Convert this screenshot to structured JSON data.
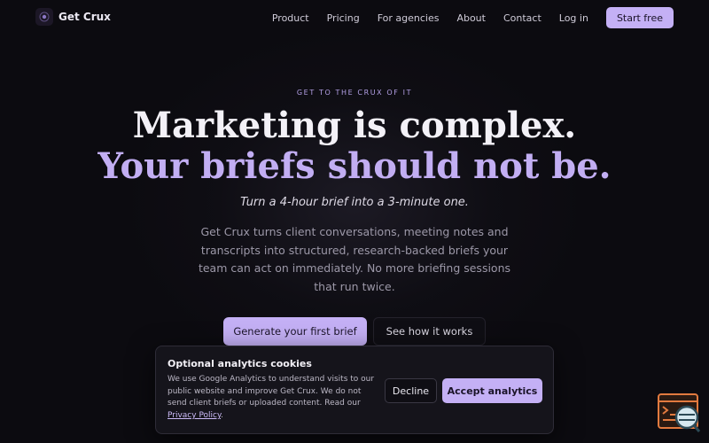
{
  "nav": {
    "brand": "Get Crux",
    "links": [
      "Product",
      "Pricing",
      "For agencies",
      "About",
      "Contact",
      "Log in"
    ],
    "cta": "Start free"
  },
  "hero": {
    "eyebrow": "GET TO THE CRUX OF IT",
    "headline_line1": "Marketing is complex.",
    "headline_line2": "Your briefs should not be.",
    "tagline": "Turn a 4-hour brief into a 3-minute one.",
    "description": "Get Crux turns client conversations, meeting notes and transcripts into structured, research-backed briefs your team can act on immediately. No more briefing sessions that run twice.",
    "primary_cta": "Generate your first brief",
    "secondary_cta": "See how it works"
  },
  "cookie": {
    "title": "Optional analytics cookies",
    "body": "We use Google Analytics to understand visits to our public website and improve Get Crux. We do not send client briefs or uploaded content. Read our",
    "link": "Privacy Policy",
    "after_link": ".",
    "decline": "Decline",
    "accept": "Accept analytics"
  },
  "icons": {
    "logo": "crux-logo-icon",
    "widget": "help-widget-icon"
  },
  "colors": {
    "accent": "#c4b0f5",
    "background": "#0c0b10",
    "widget_orange": "#e27a3f"
  }
}
